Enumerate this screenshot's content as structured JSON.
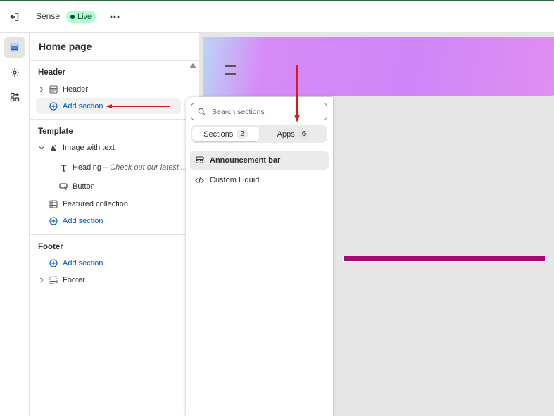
{
  "topbar": {
    "theme_name": "Sense",
    "live_label": "Live",
    "icons": {
      "exit": "exit-icon",
      "more": "ellipsis-icon"
    }
  },
  "rail": {
    "items": [
      {
        "icon": "sections-icon",
        "active": true
      },
      {
        "icon": "gear-icon",
        "active": false
      },
      {
        "icon": "apps-icon",
        "active": false
      }
    ]
  },
  "sidebar": {
    "title": "Home page",
    "header_group": {
      "title": "Header",
      "items": [
        {
          "label": "Header",
          "icon": "section-header-icon"
        }
      ],
      "add_label": "Add section"
    },
    "template_group": {
      "title": "Template",
      "image_with_text": "Image with text",
      "heading_label": "Heading",
      "heading_suffix": "– Check out our latest ...",
      "button_label": "Button",
      "featured_label": "Featured collection",
      "add_label": "Add section"
    },
    "footer_group": {
      "title": "Footer",
      "add_label": "Add section",
      "footer_label": "Footer"
    }
  },
  "popover": {
    "search_placeholder": "Search sections",
    "tabs": [
      {
        "label": "Sections",
        "count": "2",
        "active": true
      },
      {
        "label": "Apps",
        "count": "6",
        "active": false
      }
    ],
    "items": [
      {
        "label": "Announcement bar",
        "icon": "announcement-bar-icon",
        "highlighted": true
      },
      {
        "label": "Custom Liquid",
        "icon": "code-icon",
        "highlighted": false
      }
    ]
  },
  "colors": {
    "accent": "#005bd3",
    "live_bg": "#b4fed2",
    "annotation_arrow": "#e0191f",
    "announcement_bar": "#a3096e"
  }
}
